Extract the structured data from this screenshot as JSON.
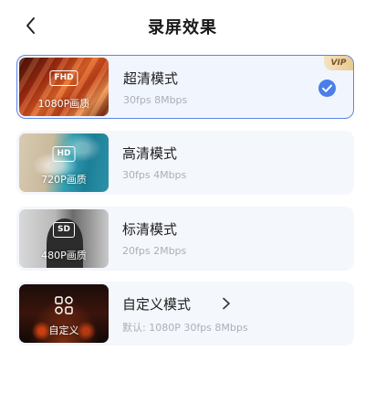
{
  "header": {
    "title": "录屏效果"
  },
  "modes": [
    {
      "badge": "FHD",
      "caption": "1080P画质",
      "name": "超清模式",
      "spec": "30fps 8Mbps",
      "vip": "VIP",
      "selected": true
    },
    {
      "badge": "HD",
      "caption": "720P画质",
      "name": "高清模式",
      "spec": "30fps 4Mbps"
    },
    {
      "badge": "SD",
      "caption": "480P画质",
      "name": "标清模式",
      "spec": "20fps 2Mbps"
    },
    {
      "caption": "自定义",
      "name": "自定义模式",
      "spec": "默认: 1080P 30fps 8Mbps",
      "icon": "grid-icon"
    }
  ],
  "colors": {
    "accent": "#4a7ee8",
    "card_bg": "#f4f7fc",
    "vip_gold": "#e8c992"
  }
}
